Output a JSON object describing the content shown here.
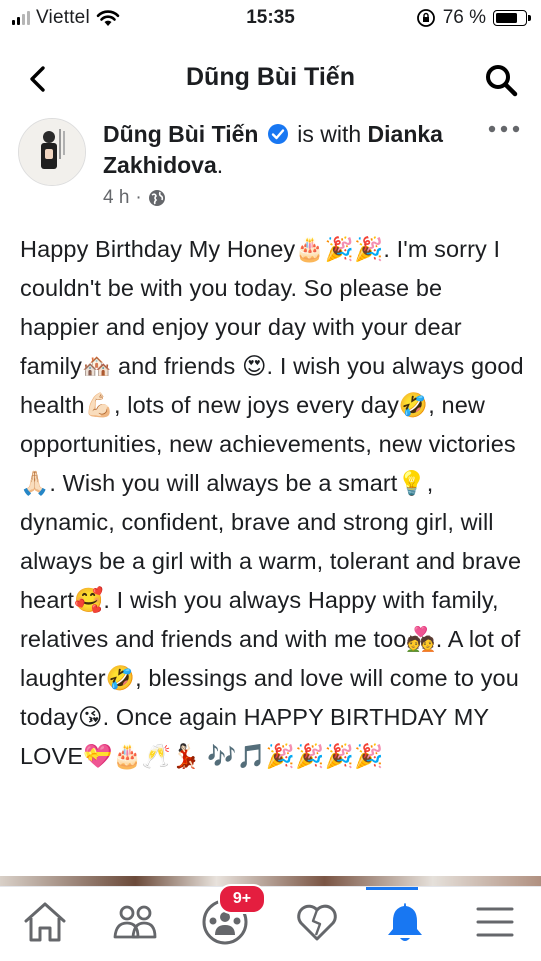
{
  "status_bar": {
    "carrier": "Viettel",
    "time": "15:35",
    "battery": "76 %",
    "battery_level": 0.76
  },
  "nav": {
    "title": "Dũng Bùi Tiến"
  },
  "post": {
    "author": "Dũng Bùi Tiến",
    "with_text": " is with ",
    "tagged": "Dianka Zakhidova",
    "tagged_end": ".",
    "time": "4 h",
    "separator": " · ",
    "body": "Happy Birthday My Honey🎂🎉🎉. I'm sorry I couldn't be with you today. So please be happier and enjoy your day with your dear family🏘️ and friends 😍. I wish you always good health💪🏻, lots of new joys every day🤣, new opportunities, new achievements, new victories🙏🏻. Wish you will always be a smart💡, dynamic, confident, brave and strong girl, will always be a girl with a warm, tolerant and brave heart🥰. I wish you always Happy with family, relatives and friends and with me too💑. A lot of laughter🤣, blessings and love will come to you today😘. Once again HAPPY BIRTHDAY MY LOVE💝🎂🥂💃🏻 🎶🎵🎉🎉🎉🎉"
  },
  "tab_bar": {
    "tabs": [
      "home-icon",
      "friends-icon",
      "groups-icon",
      "dating-heart-icon",
      "notifications-bell-icon",
      "menu-icon"
    ],
    "badge": "9+",
    "accent": "#1877f2",
    "badge_color": "#e41e3f"
  }
}
